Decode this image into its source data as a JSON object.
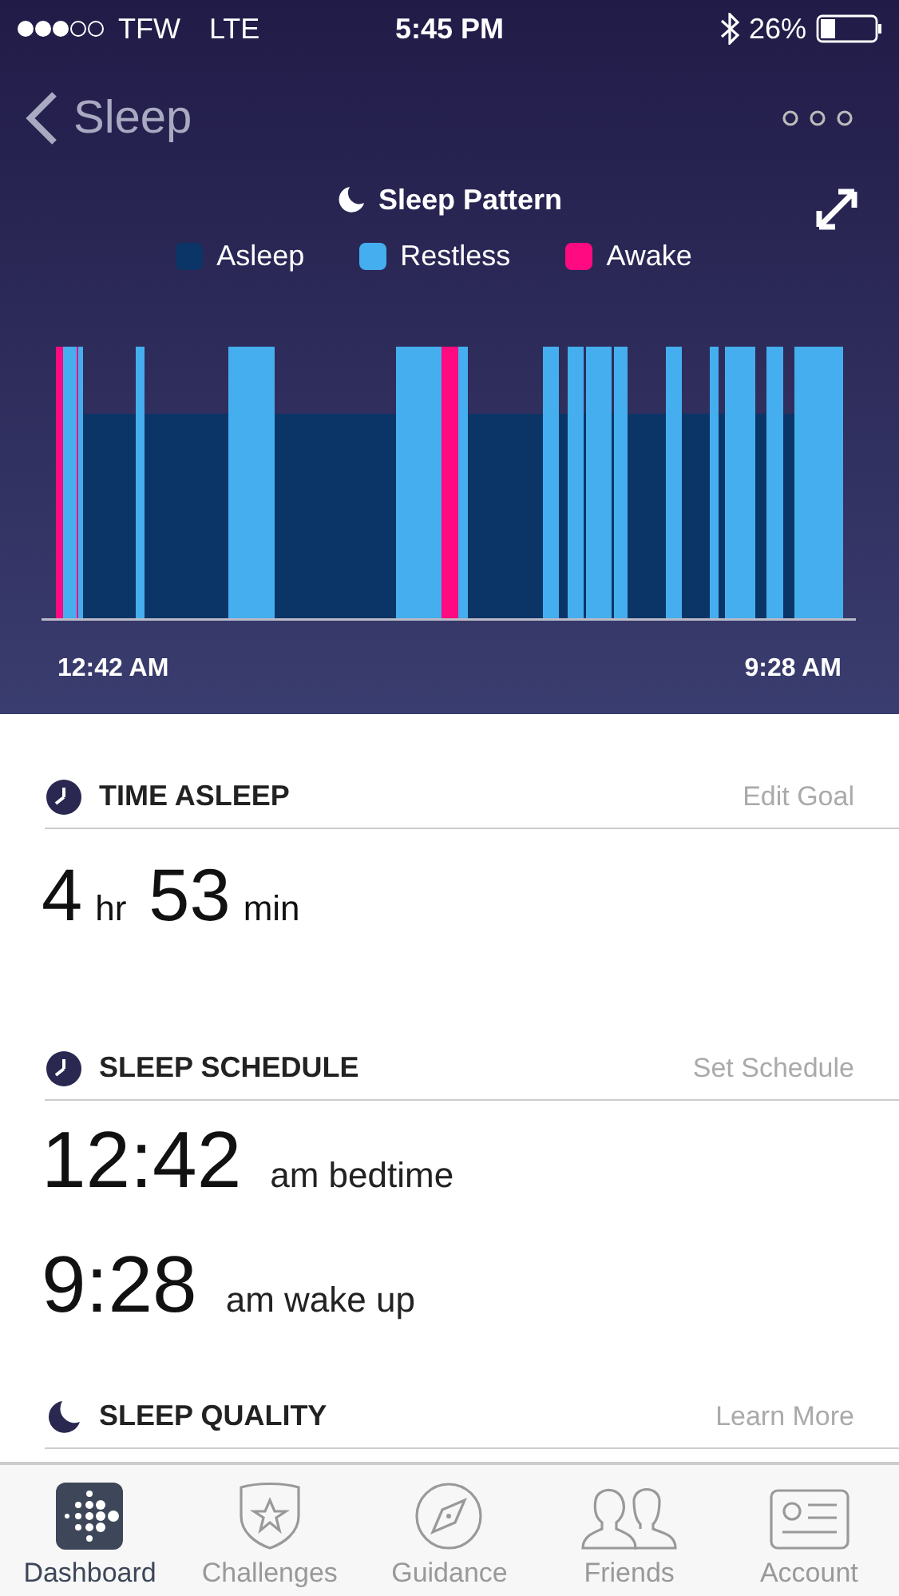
{
  "status_bar": {
    "carrier": "TFW",
    "network": "LTE",
    "time": "5:45 PM",
    "battery": "26%"
  },
  "nav": {
    "back_label": "Sleep"
  },
  "chart": {
    "title": "Sleep Pattern",
    "legend": [
      {
        "label": "Asleep",
        "color": "#0b3567"
      },
      {
        "label": "Restless",
        "color": "#45aeee"
      },
      {
        "label": "Awake",
        "color": "#ff0a80"
      }
    ],
    "start_time": "12:42 AM",
    "end_time": "9:28 AM"
  },
  "sections": [
    {
      "kind": "duration",
      "title": "TIME ASLEEP",
      "action": "Edit Goal",
      "parts": [
        {
          "value": "4",
          "unit": "hr"
        },
        {
          "value": "53",
          "unit": "min"
        }
      ]
    },
    {
      "kind": "schedule",
      "title": "SLEEP SCHEDULE",
      "action": "Set Schedule",
      "rows": [
        {
          "time": "12:42",
          "label": "am bedtime"
        },
        {
          "time": "9:28",
          "label": "am wake up"
        }
      ]
    },
    {
      "kind": "quality",
      "title": "SLEEP QUALITY",
      "action": "Learn More"
    }
  ],
  "tabs": [
    {
      "label": "Dashboard",
      "selected": true
    },
    {
      "label": "Challenges",
      "selected": false
    },
    {
      "label": "Guidance",
      "selected": false
    },
    {
      "label": "Friends",
      "selected": false
    },
    {
      "label": "Account",
      "selected": false
    }
  ]
}
